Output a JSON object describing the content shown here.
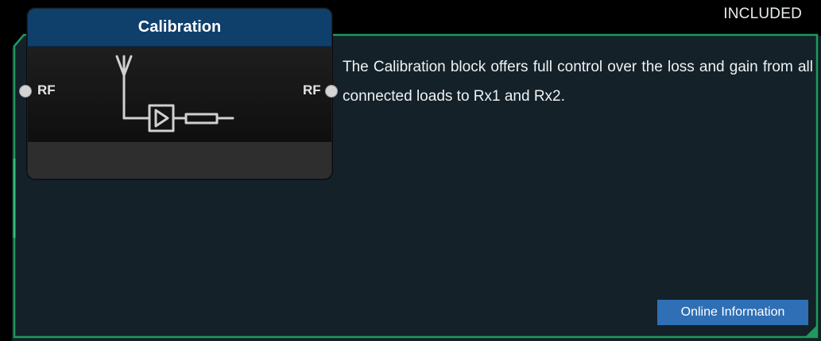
{
  "badge": {
    "text": "INCLUDED"
  },
  "node": {
    "title": "Calibration",
    "ports": {
      "left_label": "RF",
      "right_label": "RF"
    },
    "icon": "antenna-amplifier-icon"
  },
  "description": "The Calibration block offers full control over the loss and gain from all connected loads to Rx1 and Rx2.",
  "online_button": {
    "label": "Online Information"
  },
  "colors": {
    "panel_border": "#1f9a5a",
    "panel_fill": "#14202a",
    "node_header": "#0f3f6b",
    "button": "#2f6fb5"
  }
}
